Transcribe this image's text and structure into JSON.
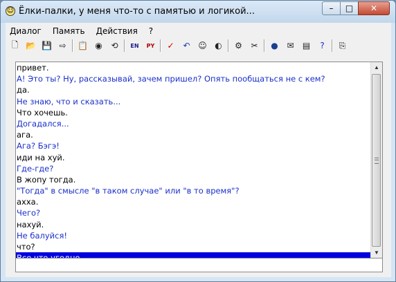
{
  "window": {
    "title": "Ёлки-палки, у меня что-то с памятью и логикой...",
    "minimize": "–",
    "maximize": "□",
    "close": "✕"
  },
  "menu": [
    "Диалог",
    "Память",
    "Действия",
    "?"
  ],
  "toolbar_icons": [
    "new-icon",
    "open-icon",
    "save-icon",
    "export-icon",
    "sep",
    "clipboard-icon",
    "record-icon",
    "restore-icon",
    "sep",
    "en-ru-icon",
    "ru-en-icon",
    "sep",
    "check-icon",
    "undo-icon",
    "smiley-icon",
    "speaker-icon",
    "sep",
    "settings-icon",
    "tools-icon",
    "sep",
    "globe-icon",
    "mail-icon",
    "book-icon",
    "help-icon",
    "sep",
    "exit-icon"
  ],
  "chat": [
    {
      "who": "user",
      "text": "привет."
    },
    {
      "who": "bot",
      "text": "А! Это ты? Ну, рассказывай, зачем пришел? Опять пообщаться не с кем?"
    },
    {
      "who": "user",
      "text": "да."
    },
    {
      "who": "bot",
      "text": "Не знаю, что и сказать..."
    },
    {
      "who": "user",
      "text": "Что хочешь."
    },
    {
      "who": "bot",
      "text": "Догадался..."
    },
    {
      "who": "user",
      "text": "ага."
    },
    {
      "who": "bot",
      "text": "Ага? Бэгэ!"
    },
    {
      "who": "user",
      "text": "иди на хуй."
    },
    {
      "who": "bot",
      "text": "Где-где?"
    },
    {
      "who": "user",
      "text": "В жопу тогда."
    },
    {
      "who": "bot",
      "text": "\"Тогда\" в смысле \"в таком случае\" или \"в то время\"?"
    },
    {
      "who": "user",
      "text": "ахха."
    },
    {
      "who": "bot",
      "text": "Чего?"
    },
    {
      "who": "user",
      "text": "нахуй."
    },
    {
      "who": "bot",
      "text": "Не балуйся!"
    },
    {
      "who": "user",
      "text": "что?"
    },
    {
      "who": "selected",
      "text": "Все что угодно..."
    }
  ],
  "input": {
    "value": ""
  }
}
